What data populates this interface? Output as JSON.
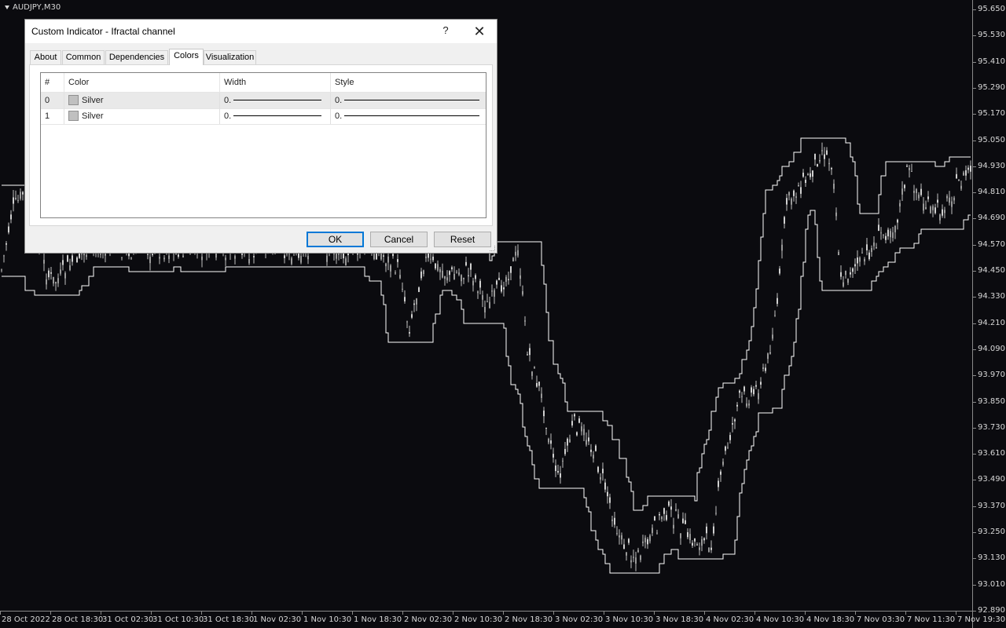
{
  "chart": {
    "symbol": "AUDJPY,M30",
    "price_labels": [
      "95.650",
      "95.530",
      "95.410",
      "95.290",
      "95.170",
      "95.050",
      "94.930",
      "94.810",
      "94.690",
      "94.570",
      "94.450",
      "94.330",
      "94.210",
      "94.090",
      "93.970",
      "93.850",
      "93.730",
      "93.610",
      "93.490",
      "93.370",
      "93.250",
      "93.130",
      "93.010",
      "92.890"
    ],
    "time_labels": [
      "28 Oct 2022",
      "28 Oct 18:30",
      "31 Oct 02:30",
      "31 Oct 10:30",
      "31 Oct 18:30",
      "1 Nov 02:30",
      "1 Nov 10:30",
      "1 Nov 18:30",
      "2 Nov 02:30",
      "2 Nov 10:30",
      "2 Nov 18:30",
      "3 Nov 02:30",
      "3 Nov 10:30",
      "3 Nov 18:30",
      "4 Nov 02:30",
      "4 Nov 10:30",
      "4 Nov 18:30",
      "7 Nov 03:30",
      "7 Nov 11:30",
      "7 Nov 19:30"
    ],
    "colors": {
      "background": "#0b0b0f",
      "candles": "#c0c0c0",
      "channel": "#ffffff",
      "axis": "#8a8a8a"
    }
  },
  "dialog": {
    "title": "Custom Indicator - Ifractal channel",
    "help_label": "?",
    "close_label": "✕",
    "tabs": [
      {
        "label": "About"
      },
      {
        "label": "Common"
      },
      {
        "label": "Dependencies"
      },
      {
        "label": "Colors",
        "active": true
      },
      {
        "label": "Visualization"
      }
    ],
    "grid": {
      "headers": [
        "#",
        "Color",
        "Width",
        "Style"
      ],
      "rows": [
        {
          "index": "0",
          "color_name": "Silver",
          "color_hex": "#c0c0c0",
          "width": "0.",
          "style": "0."
        },
        {
          "index": "1",
          "color_name": "Silver",
          "color_hex": "#c0c0c0",
          "width": "0.",
          "style": "0."
        }
      ]
    },
    "buttons": {
      "ok": "OK",
      "cancel": "Cancel",
      "reset": "Reset"
    }
  }
}
